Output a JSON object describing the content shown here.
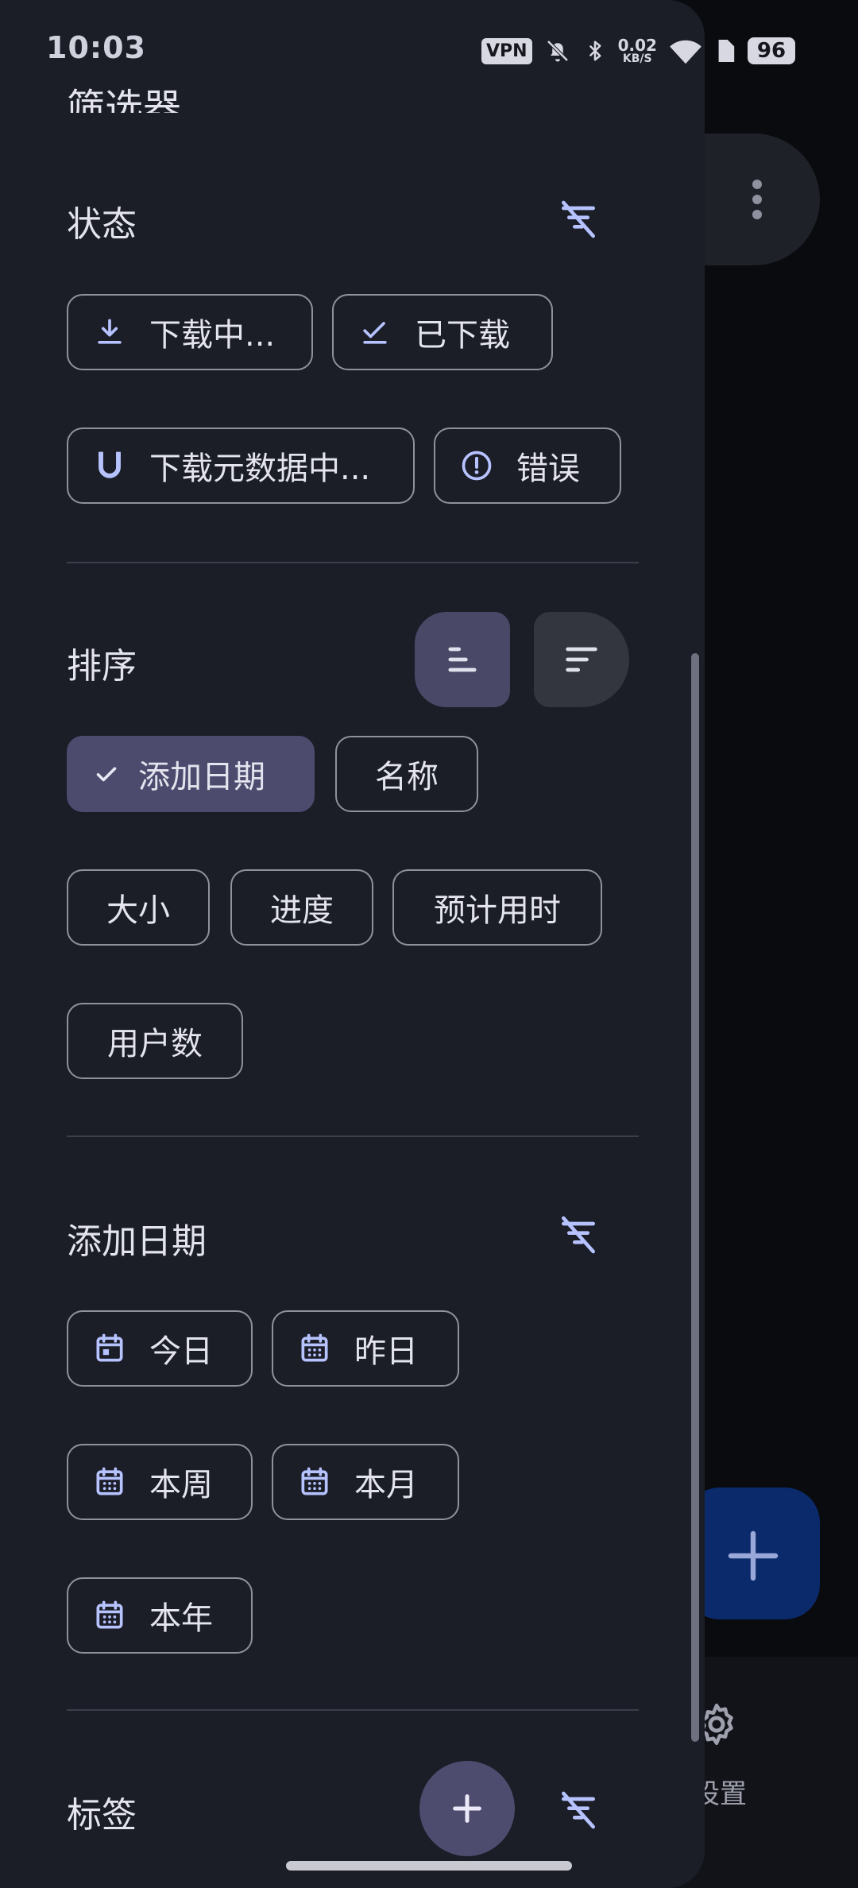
{
  "status_bar": {
    "time": "10:03",
    "vpn": "VPN",
    "speed_value": "0.02",
    "speed_unit": "KB/S",
    "battery": "96"
  },
  "background": {
    "nav_label": "设置"
  },
  "drawer": {
    "title": "筛选器",
    "status_section": {
      "title": "状态",
      "chips": [
        {
          "label": "下载中...",
          "icon": "download-icon"
        },
        {
          "label": "已下载",
          "icon": "check-list-icon"
        },
        {
          "label": "下载元数据中...",
          "icon": "magnet-icon"
        },
        {
          "label": "错误",
          "icon": "error-circle-icon"
        }
      ]
    },
    "sort_section": {
      "title": "排序",
      "chips": [
        {
          "label": "添加日期",
          "selected": true
        },
        {
          "label": "名称"
        },
        {
          "label": "大小"
        },
        {
          "label": "进度"
        },
        {
          "label": "预计用时"
        },
        {
          "label": "用户数"
        }
      ]
    },
    "date_section": {
      "title": "添加日期",
      "chips": [
        {
          "label": "今日",
          "icon": "calendar-today-icon"
        },
        {
          "label": "昨日",
          "icon": "calendar-icon"
        },
        {
          "label": "本周",
          "icon": "calendar-icon"
        },
        {
          "label": "本月",
          "icon": "calendar-icon"
        },
        {
          "label": "本年",
          "icon": "calendar-icon"
        }
      ]
    },
    "tags_section": {
      "title": "标签"
    }
  },
  "colors": {
    "drawer_bg": "#1b1d27",
    "accent_icon": "#b6c3ff",
    "selected_chip": "#4c4b6e",
    "chip_border": "#8f919d"
  }
}
